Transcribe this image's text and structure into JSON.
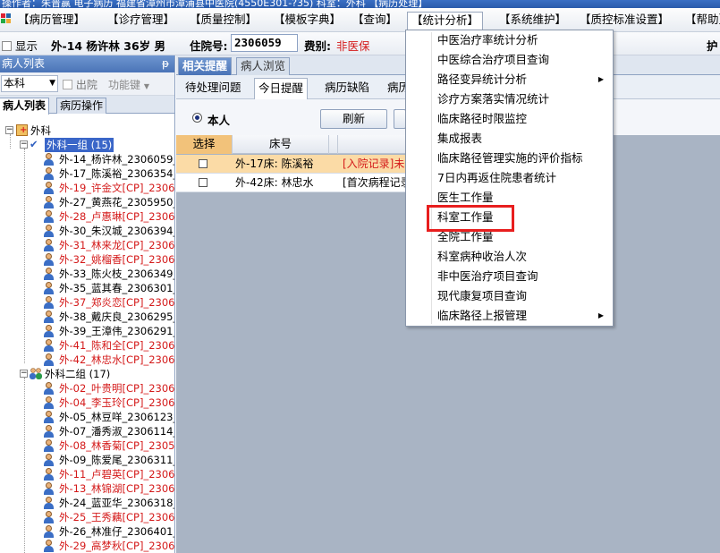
{
  "window": {
    "title": "操作者：朱晋赢 电子病历 福建省漳州市漳浦县中医院(4550E301-?35) 科室：外科 【病历处理】"
  },
  "menubar": {
    "items": [
      "【病历管理】",
      "【诊疗管理】",
      "【质量控制】",
      "【模板字典】",
      "【查询】",
      "【统计分析】",
      "【系统维护】",
      "【质控标准设置】",
      "【帮助】"
    ]
  },
  "patientbar": {
    "show_label": "显示",
    "patient": "外-14  杨许林 36岁 男",
    "hosp_no_label": "住院号:",
    "hosp_no": "2306059",
    "fee_label": "费别:",
    "fee_value": "非医保",
    "right_text": "护"
  },
  "leftpanel": {
    "title": "病人列表",
    "pin": "ᵽ",
    "dept_select": "本科",
    "discharged_label": "出院",
    "func_key_label": "功能键",
    "tabs": [
      "病人列表",
      "病历操作"
    ],
    "tree": {
      "root": "外科",
      "group1": "外科一组 (15)",
      "group1_items": [
        {
          "label": "外-14_杨许林_2306059_",
          "red": false
        },
        {
          "label": "外-17_陈溪裕_2306354_",
          "red": false
        },
        {
          "label": "外-19_许金文[CP]_2306",
          "red": true
        },
        {
          "label": "外-27_黄燕花_2305950_",
          "red": false
        },
        {
          "label": "外-28_卢惠琳[CP]_2306",
          "red": true
        },
        {
          "label": "外-30_朱汉城_2306394_",
          "red": false
        },
        {
          "label": "外-31_林来龙[CP]_2306",
          "red": true
        },
        {
          "label": "外-32_姚榴香[CP]_2306",
          "red": true
        },
        {
          "label": "外-33_陈火枝_2306349_",
          "red": false
        },
        {
          "label": "外-35_蓝其春_2306301_",
          "red": false
        },
        {
          "label": "外-37_郑炎恋[CP]_2306",
          "red": true
        },
        {
          "label": "外-38_戴庆良_2306295_",
          "red": false
        },
        {
          "label": "外-39_王漳伟_2306291_",
          "red": false
        },
        {
          "label": "外-41_陈和全[CP]_2306",
          "red": true
        },
        {
          "label": "外-42_林忠水[CP]_2306",
          "red": true
        }
      ],
      "group2": "外科二组 (17)",
      "group2_items": [
        {
          "label": "外-02_叶贵明[CP]_2306",
          "red": true
        },
        {
          "label": "外-04_李玉玲[CP]_2306",
          "red": true
        },
        {
          "label": "外-05_林豆咩_2306123_",
          "red": false
        },
        {
          "label": "外-07_潘秀淑_2306114_",
          "red": false
        },
        {
          "label": "外-08_林香菊[CP]_2305",
          "red": true
        },
        {
          "label": "外-09_陈爱尾_2306311_",
          "red": false
        },
        {
          "label": "外-11_卢碧英[CP]_2306",
          "red": true
        },
        {
          "label": "外-13_林锦湖[CP]_2306",
          "red": true
        },
        {
          "label": "外-24_蓝亚华_2306318_",
          "red": false
        },
        {
          "label": "外-25_王秀藕[CP]_2306",
          "red": true
        },
        {
          "label": "外-26_林准仔_2306401_",
          "red": false
        },
        {
          "label": "外-29_高梦秋[CP]_2306",
          "red": true
        }
      ]
    }
  },
  "rightpanel": {
    "tabs": [
      "相关提醒",
      "病人浏览"
    ],
    "subtabs": [
      "待处理问题",
      "今日提醒",
      "病历缺陷",
      "病历"
    ],
    "radio_label": "本人",
    "refresh_button": "刷新",
    "grid": {
      "columns": [
        "选择",
        "床号"
      ],
      "rows": [
        {
          "bed": "外-17床: 陈溪裕",
          "note": "[入院记录]未",
          "highlight": true
        },
        {
          "bed": "外-42床: 林忠水",
          "note": "[首次病程记录",
          "highlight": false
        }
      ]
    }
  },
  "dropdown": {
    "items": [
      {
        "label": "中医治疗率统计分析",
        "submenu": false
      },
      {
        "label": "中医综合治疗项目查询",
        "submenu": false
      },
      {
        "label": "路径变异统计分析",
        "submenu": true
      },
      {
        "label": "诊疗方案落实情况统计",
        "submenu": false
      },
      {
        "label": "临床路径时限监控",
        "submenu": false
      },
      {
        "label": "集成报表",
        "submenu": false
      },
      {
        "label": "临床路径管理实施的评价指标",
        "submenu": false
      },
      {
        "label": "7日内再返住院患者统计",
        "submenu": false
      },
      {
        "label": "医生工作量",
        "submenu": false
      },
      {
        "label": "科室工作量",
        "submenu": false
      },
      {
        "label": "全院工作量",
        "submenu": false
      },
      {
        "label": "科室病种收治人次",
        "submenu": false
      },
      {
        "label": "非中医治疗项目查询",
        "submenu": false
      },
      {
        "label": "现代康复项目查询",
        "submenu": false
      },
      {
        "label": "临床路径上报管理",
        "submenu": true
      }
    ],
    "highlighted_item": "科室工作量"
  },
  "colors": {
    "accent_blue": "#4a74b7",
    "red_text": "#d41a1a",
    "highlight_row": "#fbdba6",
    "annotation_red": "#e81e1e"
  }
}
